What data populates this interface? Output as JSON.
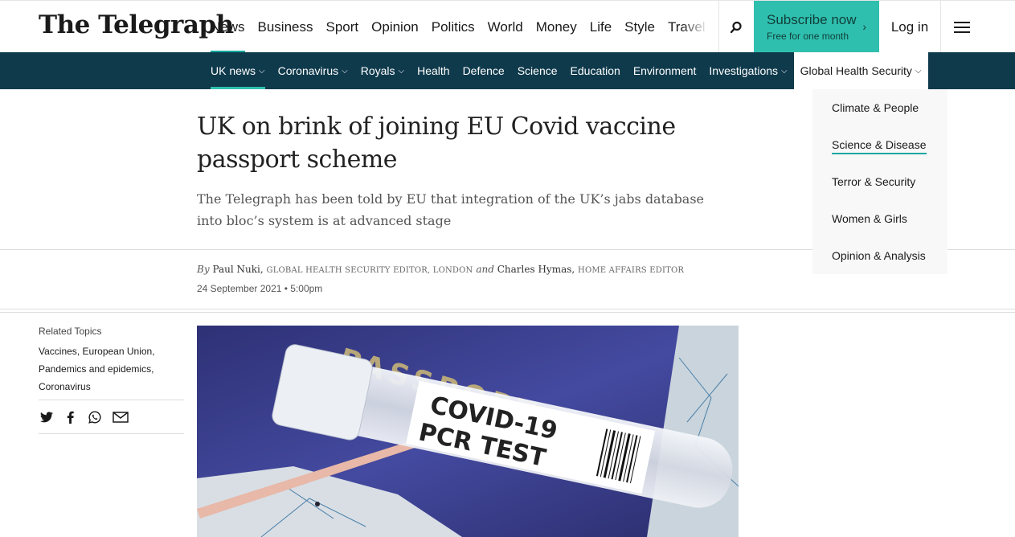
{
  "header": {
    "logo": "The Telegraph",
    "nav": [
      "News",
      "Business",
      "Sport",
      "Opinion",
      "Politics",
      "World",
      "Money",
      "Life",
      "Style",
      "Travel"
    ],
    "subscribe_label": "Subscribe now",
    "subscribe_sub": "Free for one month",
    "login_label": "Log in",
    "icons": [
      "search-icon",
      "hamburger-menu-icon"
    ]
  },
  "subnav": {
    "items": [
      {
        "label": "UK news",
        "dropdown": true
      },
      {
        "label": "Coronavirus",
        "dropdown": true
      },
      {
        "label": "Royals",
        "dropdown": true
      },
      {
        "label": "Health",
        "dropdown": false
      },
      {
        "label": "Defence",
        "dropdown": false
      },
      {
        "label": "Science",
        "dropdown": false
      },
      {
        "label": "Education",
        "dropdown": false
      },
      {
        "label": "Environment",
        "dropdown": false
      },
      {
        "label": "Investigations",
        "dropdown": true
      },
      {
        "label": "Global Health Security",
        "dropdown": true
      }
    ]
  },
  "dropdown": {
    "items": [
      "Climate & People",
      "Science & Disease",
      "Terror & Security",
      "Women & Girls",
      "Opinion & Analysis"
    ]
  },
  "article": {
    "headline": "UK on brink of joining EU Covid vaccine passport scheme",
    "standfirst": "The Telegraph has been told by EU that integration of the UK’s jabs database into bloc’s system is at advanced stage",
    "by_label": "By",
    "author1": "Paul Nuki,",
    "author1_role": "Global Health Security Editor, London",
    "and_label": "and",
    "author2": "Charles Hymas,",
    "author2_role": "Home Affairs Editor",
    "date": "24 September 2021 • 5:00pm"
  },
  "sidebar": {
    "related_label": "Related Topics",
    "topics": [
      "Vaccines",
      "European Union",
      "Pandemics and epidemics",
      "Coronavirus"
    ],
    "share_icons": [
      "twitter-icon",
      "facebook-icon",
      "whatsapp-icon",
      "email-icon"
    ]
  },
  "image": {
    "passport_text": "PASSPORT",
    "label_line1": "COVID-19",
    "label_line2": "PCR TEST"
  },
  "colors": {
    "accent": "#13a89e",
    "subscribe_bg": "#2fbfae",
    "subnav_bg": "#0f3a4c"
  }
}
